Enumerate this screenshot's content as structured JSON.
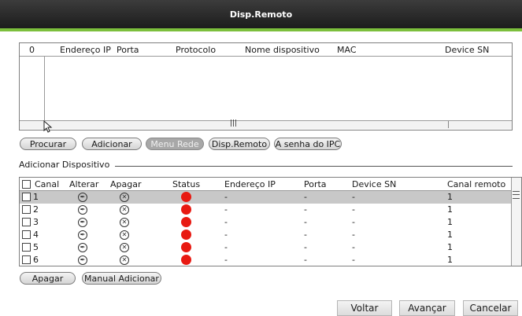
{
  "window": {
    "title": "Disp.Remoto"
  },
  "search_table": {
    "columns": [
      "0",
      "Endereço IP",
      "Porta",
      "Protocolo",
      "Nome dispositivo",
      "MAC",
      "Device SN"
    ],
    "scroll_glyph": "|||"
  },
  "toolbar": {
    "procurar": "Procurar",
    "adicionar": "Adicionar",
    "menu_rede": "Menu Rede",
    "disp_remoto": "Disp.Remoto",
    "senha_ipc": "A senha do IPC"
  },
  "section_label": "Adicionar Dispositivo",
  "added_table": {
    "columns": [
      "Canal",
      "Alterar",
      "Apagar",
      "Status",
      "Endereço IP",
      "Porta",
      "Device SN",
      "Canal remoto"
    ],
    "status_color": "#e81a12",
    "rows": [
      {
        "canal": "1",
        "ip": "-",
        "porta": "-",
        "sn": "-",
        "remoto": "1"
      },
      {
        "canal": "2",
        "ip": "-",
        "porta": "-",
        "sn": "-",
        "remoto": "1"
      },
      {
        "canal": "3",
        "ip": "-",
        "porta": "-",
        "sn": "-",
        "remoto": "1"
      },
      {
        "canal": "4",
        "ip": "-",
        "porta": "-",
        "sn": "-",
        "remoto": "1"
      },
      {
        "canal": "5",
        "ip": "-",
        "porta": "-",
        "sn": "-",
        "remoto": "1"
      },
      {
        "canal": "6",
        "ip": "-",
        "porta": "-",
        "sn": "-",
        "remoto": "1"
      }
    ]
  },
  "bottom_buttons": {
    "apagar": "Apagar",
    "manual_adicionar": "Manual Adicionar"
  },
  "footer": {
    "voltar": "Voltar",
    "avancar": "Avançar",
    "cancelar": "Cancelar"
  }
}
